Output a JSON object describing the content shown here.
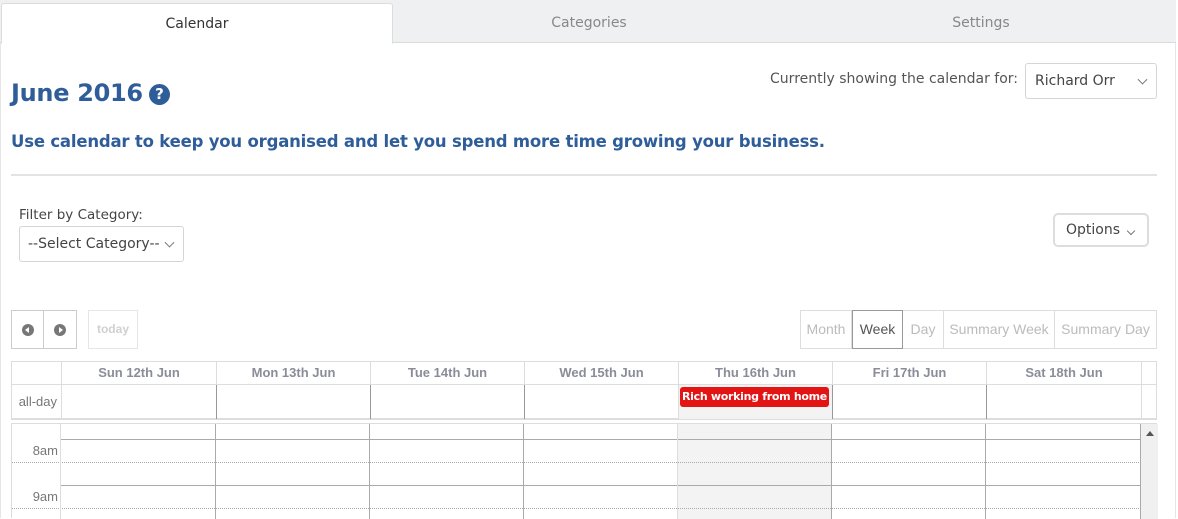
{
  "tabs": [
    {
      "label": "Calendar",
      "active": true
    },
    {
      "label": "Categories",
      "active": false
    },
    {
      "label": "Settings",
      "active": false
    }
  ],
  "header": {
    "title": "June 2016",
    "help_icon": "question-circle-icon",
    "subtitle": "Use calendar to keep you organised and let you spend more time growing your business.",
    "showing_label": "Currently showing the calendar for:",
    "user_select": {
      "value": "Richard Orr"
    }
  },
  "filter": {
    "label": "Filter by Category:",
    "select": {
      "value": "--Select Category--"
    }
  },
  "options_button": {
    "label": "Options"
  },
  "nav": {
    "prev_icon": "chevron-left-circle-icon",
    "next_icon": "chevron-right-circle-icon",
    "today_label": "today"
  },
  "views": [
    {
      "label": "Month",
      "active": false
    },
    {
      "label": "Week",
      "active": true
    },
    {
      "label": "Day",
      "active": false
    },
    {
      "label": "Summary Week",
      "active": false
    },
    {
      "label": "Summary Day",
      "active": false
    }
  ],
  "calendar": {
    "days": [
      "Sun 12th Jun",
      "Mon 13th Jun",
      "Tue 14th Jun",
      "Wed 15th Jun",
      "Thu 16th Jun",
      "Fri 17th Jun",
      "Sat 18th Jun"
    ],
    "today_index": 4,
    "allday_label": "all-day",
    "time_labels": [
      "8am",
      "9am"
    ],
    "events": [
      {
        "title": "Rich working from home",
        "day": "Thu 16th Jun",
        "all_day": true,
        "color": "#e21414"
      }
    ]
  },
  "colors": {
    "brand": "#2e5d9a",
    "event": "#e21414",
    "today_bg": "#f3f3f3"
  }
}
